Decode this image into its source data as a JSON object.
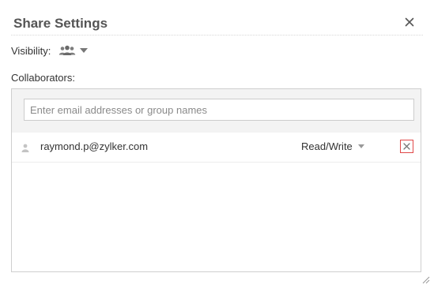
{
  "dialog": {
    "title": "Share Settings",
    "close_icon": "close-icon"
  },
  "visibility": {
    "label": "Visibility:",
    "selected_icon": "group-icon"
  },
  "collaborators": {
    "label": "Collaborators:",
    "input_placeholder": "Enter email addresses or group names",
    "input_value": "",
    "items": [
      {
        "email": "raymond.p@zylker.com",
        "permission": "Read/Write",
        "icon": "user-icon",
        "remove_icon": "remove-icon"
      }
    ]
  },
  "colors": {
    "remove_border": "#e04848",
    "title_text": "#555555",
    "input_area_bg": "#f3f3f3"
  }
}
